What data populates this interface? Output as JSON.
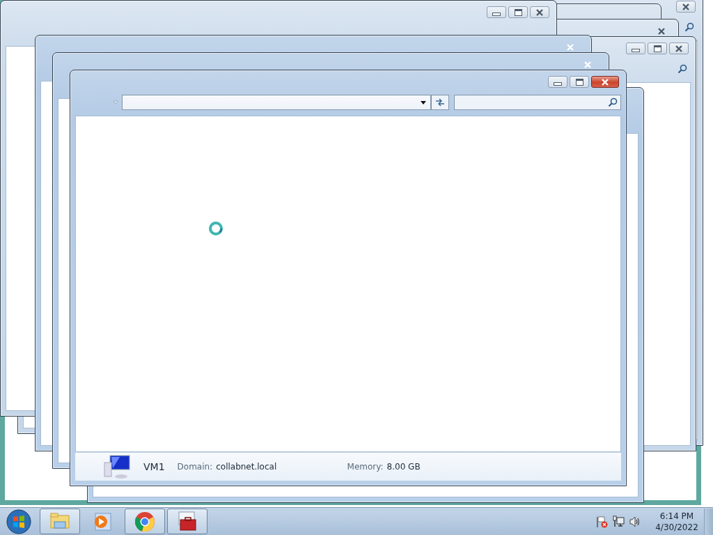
{
  "windows": [
    {
      "close_highlighted": false
    },
    {
      "close_highlighted": false
    },
    {
      "close_highlighted": false
    },
    {
      "close_highlighted": false
    },
    {
      "close_highlighted": false
    },
    {
      "close_highlighted": true
    },
    {
      "close_highlighted": true
    },
    {
      "close_highlighted": true
    },
    {
      "close_highlighted": true
    }
  ],
  "details": {
    "name": "VM1",
    "fields": [
      {
        "label": "Domain:",
        "value": "collabnet.local"
      },
      {
        "label": "Memory:",
        "value": "8.00 GB"
      }
    ]
  },
  "taskbar": {
    "buttons": [
      {
        "kind": "folder",
        "running": true
      },
      {
        "kind": "media",
        "running": false
      },
      {
        "kind": "browser",
        "running": true
      },
      {
        "kind": "toolbox",
        "running": true
      }
    ]
  },
  "clock": {
    "time": "6:14 PM",
    "date": "4/30/2022"
  }
}
